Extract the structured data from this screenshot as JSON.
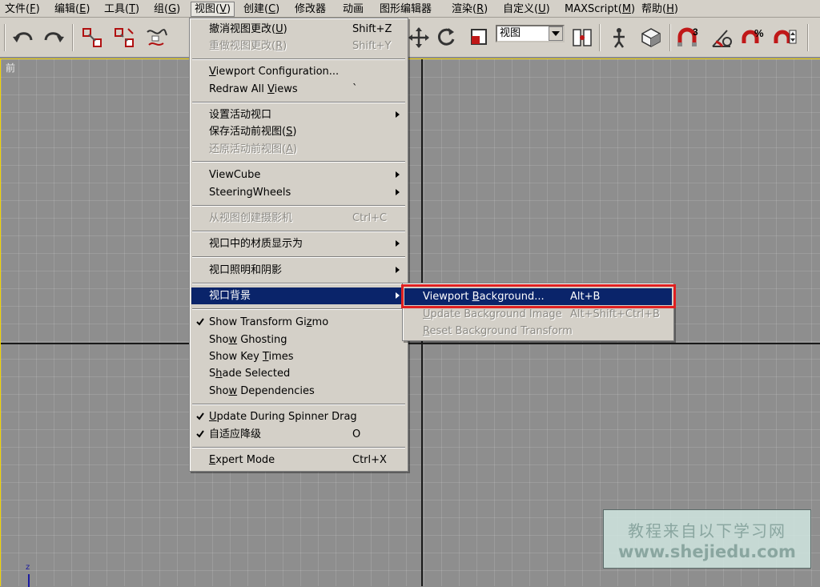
{
  "menubar": {
    "items": [
      {
        "text": "文件",
        "key": "F"
      },
      {
        "text": "编辑",
        "key": "E"
      },
      {
        "text": "工具",
        "key": "T"
      },
      {
        "text": "组",
        "key": "G"
      },
      {
        "text": "视图",
        "key": "V"
      },
      {
        "text": "创建",
        "key": "C"
      },
      {
        "text": "修改器",
        "key": ""
      },
      {
        "text": "动画",
        "key": ""
      },
      {
        "text": "图形编辑器",
        "key": ""
      },
      {
        "text": "渲染",
        "key": "R"
      },
      {
        "text": "自定义",
        "key": "U"
      },
      {
        "text": "MAXScript",
        "key": "M"
      },
      {
        "text": "帮助",
        "key": "H"
      }
    ]
  },
  "toolbar": {
    "reference_coord": "视图",
    "snap_label": "3"
  },
  "viewport": {
    "label": "前",
    "axis_label": "z"
  },
  "view_menu": {
    "undo_view": {
      "pre": "撤消视图更改(",
      "key": "U",
      "post": ")",
      "shortcut": "Shift+Z"
    },
    "redo_view": {
      "pre": "重做视图更改(",
      "key": "R",
      "post": ")",
      "shortcut": "Shift+Y"
    },
    "viewport_config": {
      "pre": "",
      "key": "V",
      "post": "iewport Configuration..."
    },
    "redraw_all": {
      "pre": "Redraw All ",
      "key": "V",
      "post": "iews",
      "shortcut": "`"
    },
    "set_active": {
      "label": "设置活动视口"
    },
    "save_active": {
      "pre": "保存活动前视图(",
      "key": "S",
      "post": ")"
    },
    "restore_active": {
      "pre": "还原活动前视图(",
      "key": "A",
      "post": ")"
    },
    "viewcube": {
      "label": "ViewCube"
    },
    "steering": {
      "label": "SteeringWheels"
    },
    "create_camera": {
      "label": "从视图创建摄影机",
      "shortcut": "Ctrl+C"
    },
    "material_display": {
      "label": "视口中的材质显示为"
    },
    "lighting": {
      "label": "视口照明和阴影"
    },
    "background": {
      "label": "视口背景"
    },
    "show_gizmo": {
      "pre": "Show Transform Gi",
      "key": "z",
      "post": "mo"
    },
    "show_ghosting": {
      "pre": "Sho",
      "key": "w",
      "post": " Ghosting"
    },
    "show_key_times": {
      "pre": "Show Key ",
      "key": "T",
      "post": "imes"
    },
    "shade_selected": {
      "pre": "S",
      "key": "h",
      "post": "ade Selected"
    },
    "show_dependencies": {
      "pre": "Sho",
      "key": "w",
      "post": " Dependencies"
    },
    "spinner_drag": {
      "pre": "",
      "key": "U",
      "post": "pdate During Spinner Drag"
    },
    "adaptive_degradation": {
      "label": "自适应降级",
      "shortcut": "O"
    },
    "expert_mode": {
      "pre": "",
      "key": "E",
      "post": "xpert Mode",
      "shortcut": "Ctrl+X"
    }
  },
  "background_submenu": {
    "viewport_background": {
      "pre": "Viewport ",
      "key": "B",
      "post": "ackground...",
      "shortcut": "Alt+B"
    },
    "update_background": {
      "pre": "",
      "key": "U",
      "post": "pdate Background Image",
      "shortcut": "Alt+Shift+Ctrl+B"
    },
    "reset_transform": {
      "pre": "",
      "key": "R",
      "post": "eset Background Transform"
    }
  },
  "watermark": {
    "line1": "教程来自以下学习网",
    "line2": "www.shejiedu.com"
  },
  "colors": {
    "highlight": "#0a246a",
    "callout": "#e02020",
    "viewport_border": "#f0d200"
  }
}
